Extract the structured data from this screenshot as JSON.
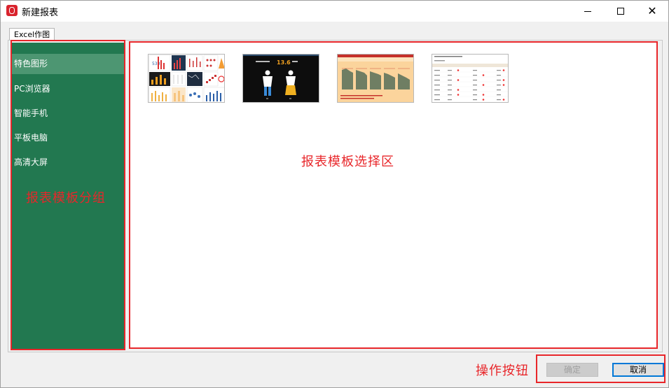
{
  "window": {
    "title": "新建报表"
  },
  "tab": {
    "label": "Excel作图"
  },
  "sidebar": {
    "items": [
      {
        "label": "特色图形",
        "active": true
      },
      {
        "label": "PC浏览器",
        "active": false
      },
      {
        "label": "智能手机",
        "active": false
      },
      {
        "label": "平板电脑",
        "active": false
      },
      {
        "label": "高清大屏",
        "active": false
      }
    ]
  },
  "annotations": {
    "sidebar": "报表模板分组",
    "templates": "报表模板选择区",
    "buttons": "操作按钮"
  },
  "templates": [
    {
      "kind": "dashboard-grid"
    },
    {
      "kind": "population-dark",
      "value": "13.6"
    },
    {
      "kind": "orange-area-charts"
    },
    {
      "kind": "table-list"
    }
  ],
  "buttons": {
    "ok": "确定",
    "cancel": "取消"
  },
  "colors": {
    "sidebar": "#227850",
    "sidebar_active": "#4d9672",
    "annotation_red": "#e8262a",
    "accent": "#0078d7"
  }
}
